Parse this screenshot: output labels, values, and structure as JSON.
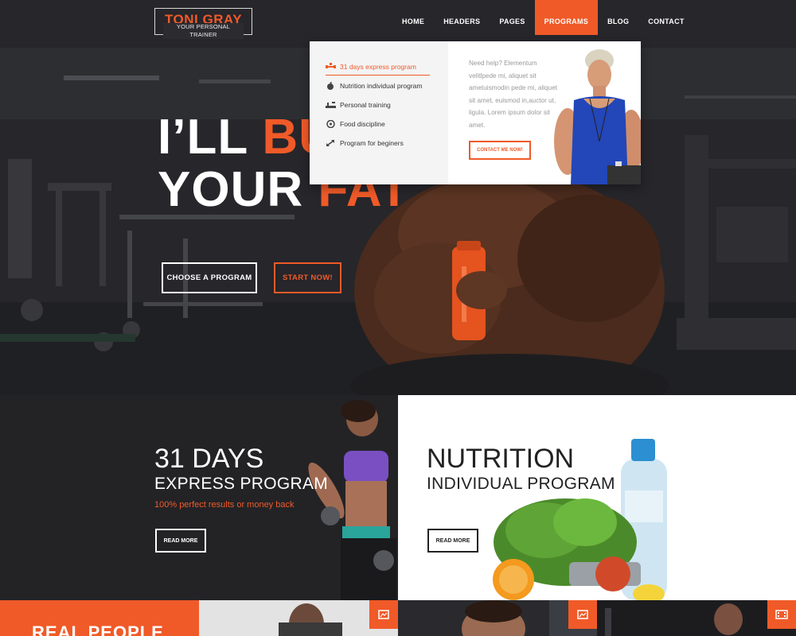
{
  "brand": {
    "name": "TONI GRAY",
    "tagline": "YOUR PERSONAL TRAINER"
  },
  "nav": {
    "items": [
      {
        "label": "HOME"
      },
      {
        "label": "HEADERS"
      },
      {
        "label": "PAGES"
      },
      {
        "label": "PROGRAMS",
        "active": true
      },
      {
        "label": "BLOG"
      },
      {
        "label": "CONTACT"
      }
    ]
  },
  "dropdown": {
    "items": [
      {
        "label": "31 days express program",
        "icon": "dumbbell-icon",
        "active": true
      },
      {
        "label": "Nutrition individual program",
        "icon": "apple-icon"
      },
      {
        "label": "Personal training",
        "icon": "treadmill-icon"
      },
      {
        "label": "Food discipline",
        "icon": "scale-icon"
      },
      {
        "label": "Program for beginers",
        "icon": "expand-arrows-icon"
      }
    ],
    "help_text": "Need help? Elementum velitlpede mi, aliquet sit ametuismodin pede mi, aliquet sit amet, euismod in,auctor ut, ligula. Lorem ipsum dolor sit amet.",
    "contact_label": "CONTACT ME NOW!"
  },
  "hero": {
    "line1_white": "I’LL ",
    "line1_orange": "BU",
    "line2_white": "YOUR ",
    "line2_orange": "FAT",
    "choose_label": "CHOOSE A PROGRAM",
    "start_label": "START NOW!"
  },
  "programs": [
    {
      "title": "31 DAYS",
      "subtitle": "EXPRESS PROGRAM",
      "note": "100% perfect results or money back",
      "read_more": "READ MORE"
    },
    {
      "title": "NUTRITION",
      "subtitle": "INDIVIDUAL PROGRAM",
      "read_more": "READ MORE"
    }
  ],
  "bottom": {
    "heading": "REAL PEOPLE"
  },
  "colors": {
    "accent": "#f05a28",
    "dark": "#232326",
    "light": "#ffffff"
  }
}
